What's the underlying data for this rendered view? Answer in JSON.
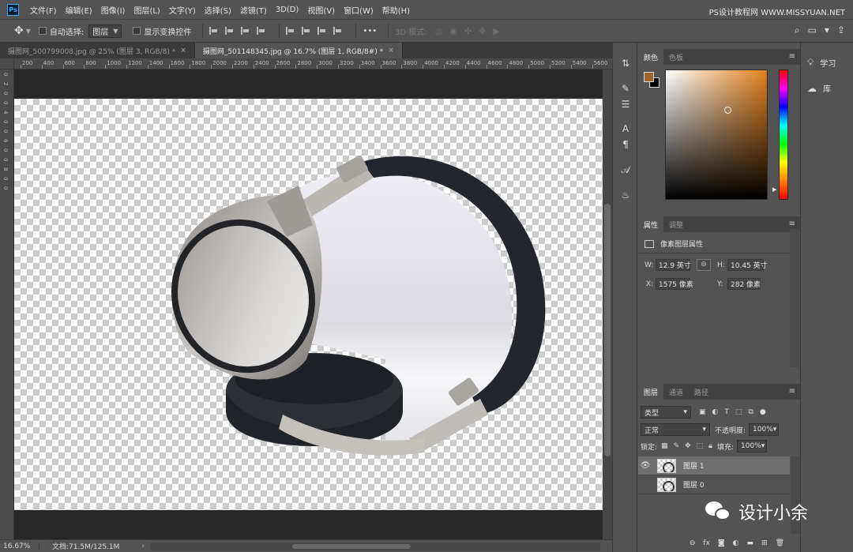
{
  "menubar": {
    "app_icon": "Ps",
    "items": [
      "文件(F)",
      "编辑(E)",
      "图像(I)",
      "图层(L)",
      "文字(Y)",
      "选择(S)",
      "滤镜(T)",
      "3D(D)",
      "视图(V)",
      "窗口(W)",
      "帮助(H)"
    ],
    "watermark": "PS设计教程网 WWW.MISSYUAN.NET"
  },
  "options": {
    "auto_select_label": "自动选择:",
    "auto_select_value": "图层",
    "show_transform_label": "显示变换控件",
    "more_label": "•••",
    "mode_3d_label": "3D 模式:"
  },
  "tabs": [
    {
      "label": "摄图网_500799008.jpg @ 25% (图层 3, RGB/8) *"
    },
    {
      "label": "摄图网_501148345.jpg @ 16.7% (图层 1, RGB/8#) *"
    }
  ],
  "ruler": {
    "top_labels": [
      "200",
      "400",
      "600",
      "800",
      "1000",
      "1200",
      "1400",
      "1600",
      "1800",
      "2000",
      "2200",
      "2400",
      "2600",
      "2800",
      "3000",
      "3200",
      "3400",
      "3600",
      "3800",
      "4000",
      "4200",
      "4400",
      "4600",
      "4800",
      "5000",
      "5200",
      "5400",
      "5600"
    ],
    "left_labels": [
      "0",
      "2",
      "0",
      "0",
      "4",
      "0",
      "0",
      "6",
      "0",
      "0",
      "8",
      "0",
      "0"
    ]
  },
  "status": {
    "zoom": "16.67%",
    "doc": "文档:71.5M/125.1M",
    "arrow": "›"
  },
  "color_panel": {
    "tabs": [
      "颜色",
      "色板"
    ],
    "foreground": "#a0642c",
    "background": "#000000",
    "hue": "#e2801d"
  },
  "properties": {
    "tabs": [
      "属性",
      "调整"
    ],
    "title": "像素图层属性",
    "w_label": "W:",
    "w_value": "12.9 英寸",
    "h_label": "H:",
    "h_value": "10.45 英寸",
    "x_label": "X:",
    "x_value": "1575 像素",
    "y_label": "Y:",
    "y_value": "282 像素"
  },
  "layers": {
    "tabs": [
      "图层",
      "通道",
      "路径"
    ],
    "filter_label": "类型",
    "blend_mode": "正常",
    "opacity_label": "不透明度:",
    "opacity_value": "100%",
    "lock_label": "锁定:",
    "fill_label": "填充:",
    "fill_value": "100%",
    "items": [
      {
        "name": "图层 1",
        "visible": true,
        "selected": true
      },
      {
        "name": "图层 0",
        "visible": false,
        "selected": false
      }
    ]
  },
  "side": {
    "learn": "学习",
    "library": "库"
  },
  "watermark_bottom": "设计小余"
}
